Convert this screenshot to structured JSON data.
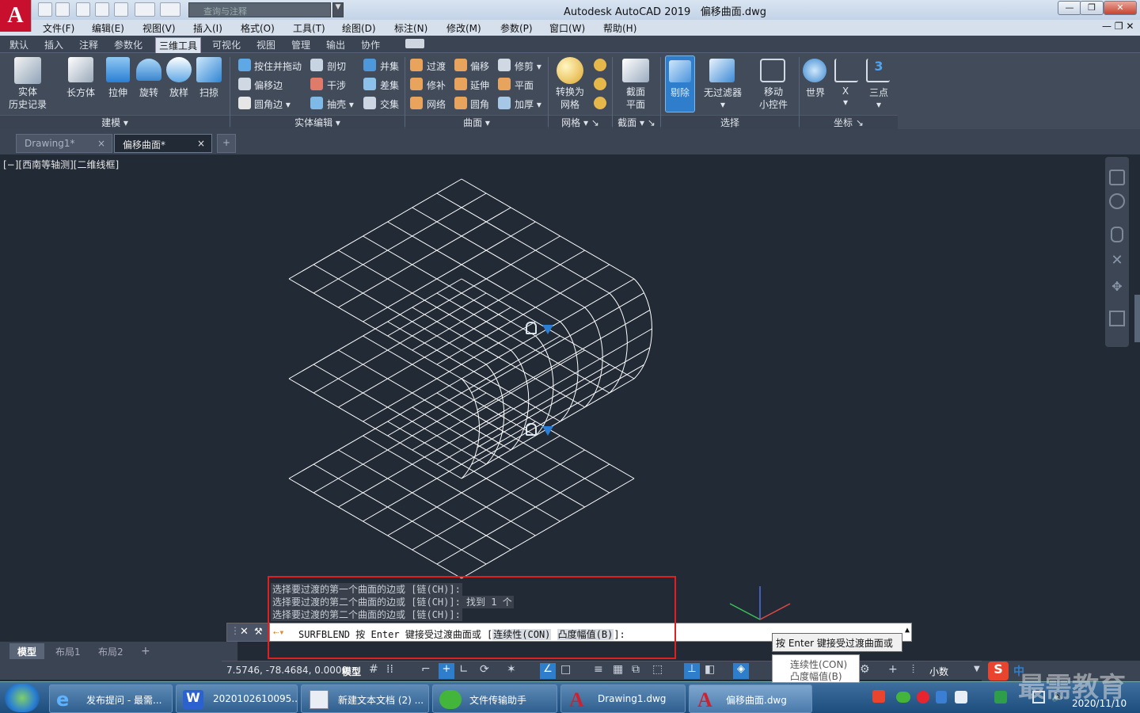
{
  "title_bar": {
    "app_logo": "A",
    "app_title": "Autodesk AutoCAD 2019",
    "file_title": "偏移曲面.dwg",
    "search_placeholder": "查询与注释",
    "controls": [
      "—",
      "❐",
      "✕"
    ]
  },
  "menu_bar": {
    "items": [
      "文件(F)",
      "编辑(E)",
      "视图(V)",
      "插入(I)",
      "格式(O)",
      "工具(T)",
      "绘图(D)",
      "标注(N)",
      "修改(M)",
      "参数(P)",
      "窗口(W)",
      "帮助(H)"
    ]
  },
  "ribbon_tabs": {
    "items": [
      "默认",
      "插入",
      "注释",
      "参数化",
      "三维工具",
      "可视化",
      "视图",
      "管理",
      "输出",
      "协作"
    ],
    "active": "三维工具"
  },
  "ribbon": {
    "modeling": {
      "history": "实体\n历史记录",
      "box": "长方体",
      "extrude": "拉伸",
      "revolve": "旋转",
      "loft": "放样",
      "sweep": "扫掠",
      "panel": "建模"
    },
    "solid_edit": {
      "presspull": "按住并拖动",
      "offset_edge": "偏移边",
      "fillet_edge": "圆角边",
      "slice": "剖切",
      "interfere": "干涉",
      "shell": "抽壳",
      "union": "并集",
      "subtract": "差集",
      "intersect": "交集",
      "panel": "实体编辑"
    },
    "surface": {
      "blend": "过渡",
      "patch": "修补",
      "network": "网络",
      "offset": "偏移",
      "extend": "延伸",
      "fillet": "圆角",
      "trim": "修剪",
      "planar": "平面",
      "sculpt": "加厚",
      "panel": "曲面"
    },
    "mesh": {
      "convert": "转换为\n网格",
      "panel": "网格"
    },
    "section": {
      "plane": "截面\n平面",
      "panel": "截面"
    },
    "selection": {
      "cull": "剔除",
      "filter": "无过滤器",
      "gizmo": "移动\n小控件",
      "panel": "选择"
    },
    "coordinates": {
      "world": "世界",
      "x": "X",
      "three_point": "三点",
      "panel": "坐标"
    }
  },
  "doc_tabs": {
    "items": [
      "Drawing1*",
      "偏移曲面*"
    ],
    "active": "偏移曲面*",
    "add": "+"
  },
  "viewport": {
    "label": "[−][西南等轴测][二维线框]"
  },
  "command": {
    "history": [
      "选择要过渡的第一个曲面的边或 [链(CH)]:",
      "选择要过渡的第二个曲面的边或 [链(CH)]: 找到 1 个",
      "选择要过渡的第二个曲面的边或 [链(CH)]:"
    ],
    "prompt_prefix": "SURFBLEND 按 Enter 键接受过渡曲面或 [",
    "option1": "连续性(CON)",
    "option2": "凸度幅值(B)",
    "prompt_suffix": "]:",
    "tooltip": "按 Enter 键接受过渡曲面或",
    "dropdown": [
      "连续性(CON)",
      "凸度幅值(B)"
    ]
  },
  "layout_tabs": {
    "items": [
      "模型",
      "布局1",
      "布局2"
    ],
    "active": "模型"
  },
  "status_bar": {
    "coords": "7.5746, -78.4684, 0.0000",
    "model": "模型",
    "units": "小数"
  },
  "taskbar": {
    "items": [
      "发布提问 - 最需...",
      "2020102610095...",
      "新建文本文档 (2) ...",
      "文件传输助手",
      "Drawing1.dwg",
      "偏移曲面.dwg"
    ],
    "active": "偏移曲面.dwg",
    "time": "2020/11/10",
    "watermark": "最需教育",
    "ime": "中"
  },
  "colors": {
    "canvas": "#222a35",
    "ribbon": "#414b5a",
    "wire": "#ffffff",
    "accent": "#2a7fd4",
    "highlight_box": "#e02020"
  }
}
